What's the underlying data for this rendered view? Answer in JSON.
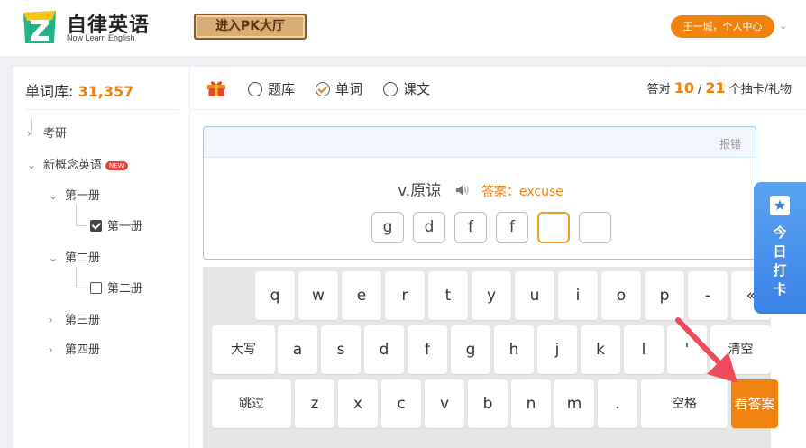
{
  "header": {
    "logo_title": "自律英语",
    "logo_sub": "Now Learn English",
    "pk_label": "进入PK大厅",
    "user_label": "王一城，个人中心"
  },
  "sidebar": {
    "lib_label": "单词库:",
    "lib_count": "31,357",
    "items": [
      {
        "label": "考研"
      },
      {
        "label": "新概念英语",
        "badge": "NEW"
      },
      {
        "label": "第一册"
      },
      {
        "label": "第一册",
        "checked": true
      },
      {
        "label": "第二册"
      },
      {
        "label": "第二册",
        "checked": false
      },
      {
        "label": "第三册"
      },
      {
        "label": "第四册"
      }
    ]
  },
  "toolbar": {
    "radios": [
      {
        "label": "题库",
        "checked": false
      },
      {
        "label": "单词",
        "checked": true
      },
      {
        "label": "课文",
        "checked": false
      }
    ],
    "score_prefix": "答对",
    "correct": "10",
    "sep": "/",
    "total": "21",
    "score_suffix": "个抽卡/礼物"
  },
  "card": {
    "report": "报错",
    "meaning": "v.原谅",
    "answer": "答案：excuse",
    "letters": [
      "g",
      "d",
      "f",
      "f",
      "",
      ""
    ]
  },
  "keyboard": {
    "row1": [
      "q",
      "w",
      "e",
      "r",
      "t",
      "y",
      "u",
      "i",
      "o",
      "p",
      "-",
      "«"
    ],
    "row2": [
      "大写",
      "a",
      "s",
      "d",
      "f",
      "g",
      "h",
      "j",
      "k",
      "l",
      "'",
      "清空"
    ],
    "row3": [
      "跳过",
      "z",
      "x",
      "c",
      "v",
      "b",
      "n",
      "m",
      ".",
      "空格",
      "看答案"
    ]
  },
  "checkin": {
    "star": "★",
    "label": "今日打卡"
  },
  "colors": {
    "accent": "#f0820f",
    "logo_green": "#1bb38a",
    "checkin_blue": "#3b82e6",
    "arrow_red": "#ee4b5a"
  }
}
